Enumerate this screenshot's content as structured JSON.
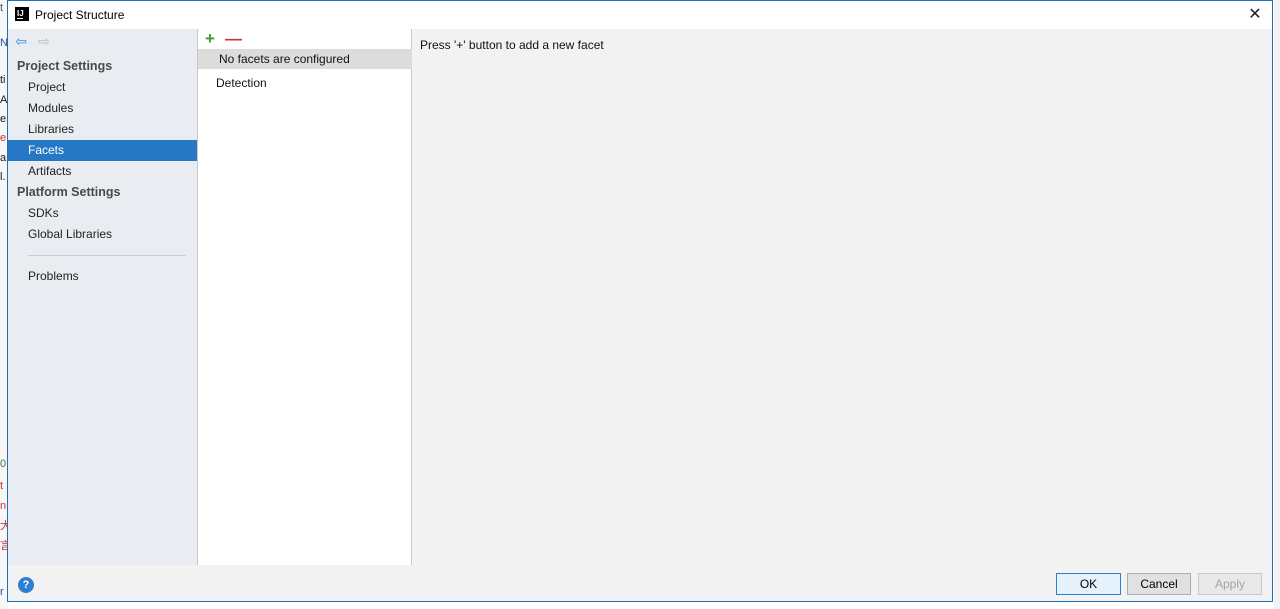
{
  "background_app": {
    "edge_chars": [
      "t",
      "N",
      "ti",
      "A",
      "e",
      "e",
      "a",
      "l.",
      "0",
      "t",
      "n",
      "大",
      "言",
      "r"
    ]
  },
  "window": {
    "title": "Project Structure",
    "close_label": "✕"
  },
  "nav": {
    "back_glyph": "⇦",
    "forward_glyph": "⇨",
    "project_settings_heading": "Project Settings",
    "project_items": [
      "Project",
      "Modules",
      "Libraries",
      "Facets",
      "Artifacts"
    ],
    "selected_item": "Facets",
    "platform_settings_heading": "Platform Settings",
    "platform_items": [
      "SDKs",
      "Global Libraries"
    ],
    "problems_label": "Problems"
  },
  "facets": {
    "add_glyph": "+",
    "remove_glyph": "—",
    "empty_text": "No facets are configured",
    "detection_label": "Detection"
  },
  "content": {
    "hint": "Press '+' button to add a new facet"
  },
  "footer": {
    "help_glyph": "?",
    "ok_label": "OK",
    "cancel_label": "Cancel",
    "apply_label": "Apply"
  },
  "colors": {
    "accent": "#2677c4",
    "add_green": "#3b9a3b",
    "remove_red": "#cc3333"
  }
}
